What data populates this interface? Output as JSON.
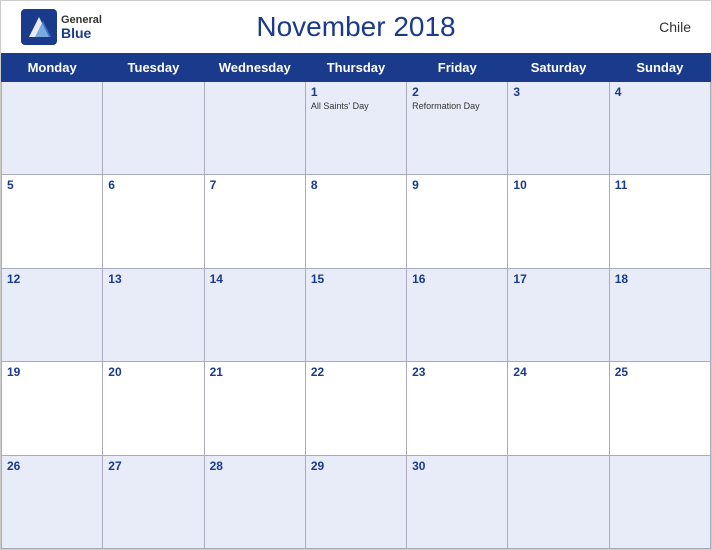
{
  "header": {
    "title": "November 2018",
    "country": "Chile",
    "logo": {
      "general": "General",
      "blue": "Blue"
    }
  },
  "days_of_week": [
    "Monday",
    "Tuesday",
    "Wednesday",
    "Thursday",
    "Friday",
    "Saturday",
    "Sunday"
  ],
  "weeks": [
    [
      {
        "day": "",
        "holiday": ""
      },
      {
        "day": "",
        "holiday": ""
      },
      {
        "day": "",
        "holiday": ""
      },
      {
        "day": "1",
        "holiday": "All Saints' Day"
      },
      {
        "day": "2",
        "holiday": "Reformation Day"
      },
      {
        "day": "3",
        "holiday": ""
      },
      {
        "day": "4",
        "holiday": ""
      }
    ],
    [
      {
        "day": "5",
        "holiday": ""
      },
      {
        "day": "6",
        "holiday": ""
      },
      {
        "day": "7",
        "holiday": ""
      },
      {
        "day": "8",
        "holiday": ""
      },
      {
        "day": "9",
        "holiday": ""
      },
      {
        "day": "10",
        "holiday": ""
      },
      {
        "day": "11",
        "holiday": ""
      }
    ],
    [
      {
        "day": "12",
        "holiday": ""
      },
      {
        "day": "13",
        "holiday": ""
      },
      {
        "day": "14",
        "holiday": ""
      },
      {
        "day": "15",
        "holiday": ""
      },
      {
        "day": "16",
        "holiday": ""
      },
      {
        "day": "17",
        "holiday": ""
      },
      {
        "day": "18",
        "holiday": ""
      }
    ],
    [
      {
        "day": "19",
        "holiday": ""
      },
      {
        "day": "20",
        "holiday": ""
      },
      {
        "day": "21",
        "holiday": ""
      },
      {
        "day": "22",
        "holiday": ""
      },
      {
        "day": "23",
        "holiday": ""
      },
      {
        "day": "24",
        "holiday": ""
      },
      {
        "day": "25",
        "holiday": ""
      }
    ],
    [
      {
        "day": "26",
        "holiday": ""
      },
      {
        "day": "27",
        "holiday": ""
      },
      {
        "day": "28",
        "holiday": ""
      },
      {
        "day": "29",
        "holiday": ""
      },
      {
        "day": "30",
        "holiday": ""
      },
      {
        "day": "",
        "holiday": ""
      },
      {
        "day": "",
        "holiday": ""
      }
    ]
  ]
}
